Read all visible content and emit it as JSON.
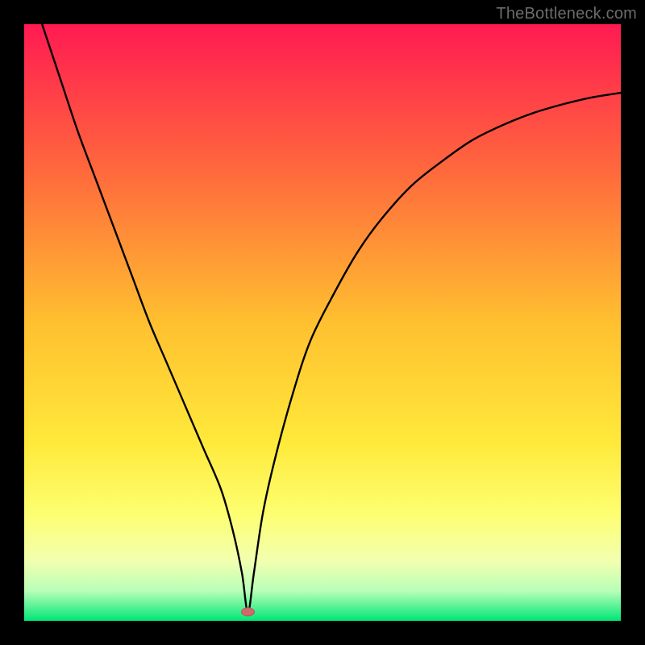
{
  "watermark": "TheBottleneck.com",
  "chart_data": {
    "type": "line",
    "title": "",
    "xlabel": "",
    "ylabel": "",
    "xlim": [
      0,
      100
    ],
    "ylim": [
      0,
      100
    ],
    "grid": false,
    "legend": false,
    "background_gradient_stops": [
      {
        "offset": 0.0,
        "color": "#ff1a52"
      },
      {
        "offset": 0.25,
        "color": "#ff6a3c"
      },
      {
        "offset": 0.5,
        "color": "#ffc030"
      },
      {
        "offset": 0.7,
        "color": "#ffe93a"
      },
      {
        "offset": 0.82,
        "color": "#fdff70"
      },
      {
        "offset": 0.9,
        "color": "#f2ffb0"
      },
      {
        "offset": 0.95,
        "color": "#b8ffb8"
      },
      {
        "offset": 1.0,
        "color": "#00e676"
      }
    ],
    "marker": {
      "x": 37.5,
      "y": 1.5,
      "color": "#cf6a6a"
    },
    "series": [
      {
        "name": "curve",
        "x": [
          3,
          6,
          9,
          12,
          15,
          18,
          21,
          24,
          27,
          30,
          33,
          35,
          36.5,
          37.5,
          38.5,
          40,
          42,
          45,
          48,
          52,
          56,
          60,
          65,
          70,
          75,
          80,
          85,
          90,
          95,
          100
        ],
        "y": [
          100,
          91,
          82,
          74,
          66,
          58,
          50,
          43,
          36,
          29,
          22,
          15,
          8,
          1.5,
          8,
          18,
          27,
          38,
          47,
          55,
          62,
          67.5,
          73,
          77,
          80.5,
          83,
          85,
          86.5,
          87.7,
          88.5
        ]
      }
    ]
  }
}
